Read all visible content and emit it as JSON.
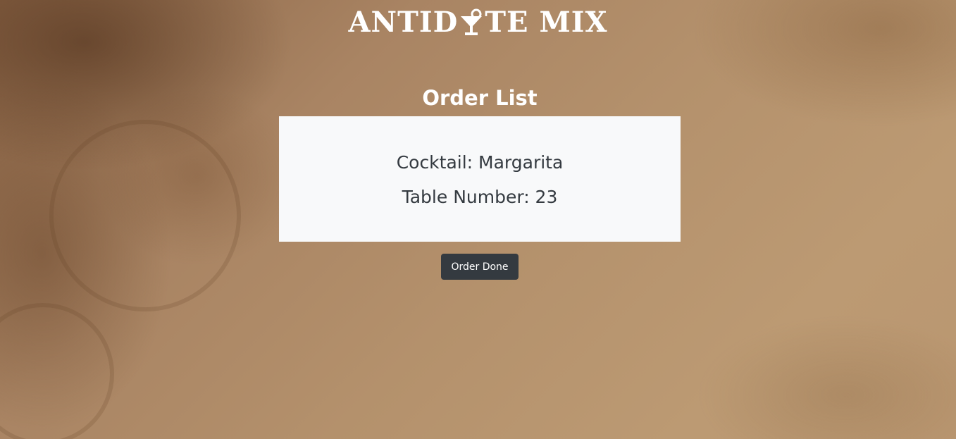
{
  "brand": {
    "logo_text_before": "ANTID",
    "logo_text_after": "TE MIX",
    "logo_icon": "cocktail-glass-icon"
  },
  "page": {
    "title": "Order List"
  },
  "order": {
    "cocktail_label": "Cocktail: Margarita",
    "table_label": "Table Number: 23"
  },
  "actions": {
    "done_label": "Order Done"
  },
  "colors": {
    "card_bg": "#f8f9fa",
    "button_bg": "#343a40",
    "text_dark": "#343a40",
    "text_light": "#ffffff"
  }
}
